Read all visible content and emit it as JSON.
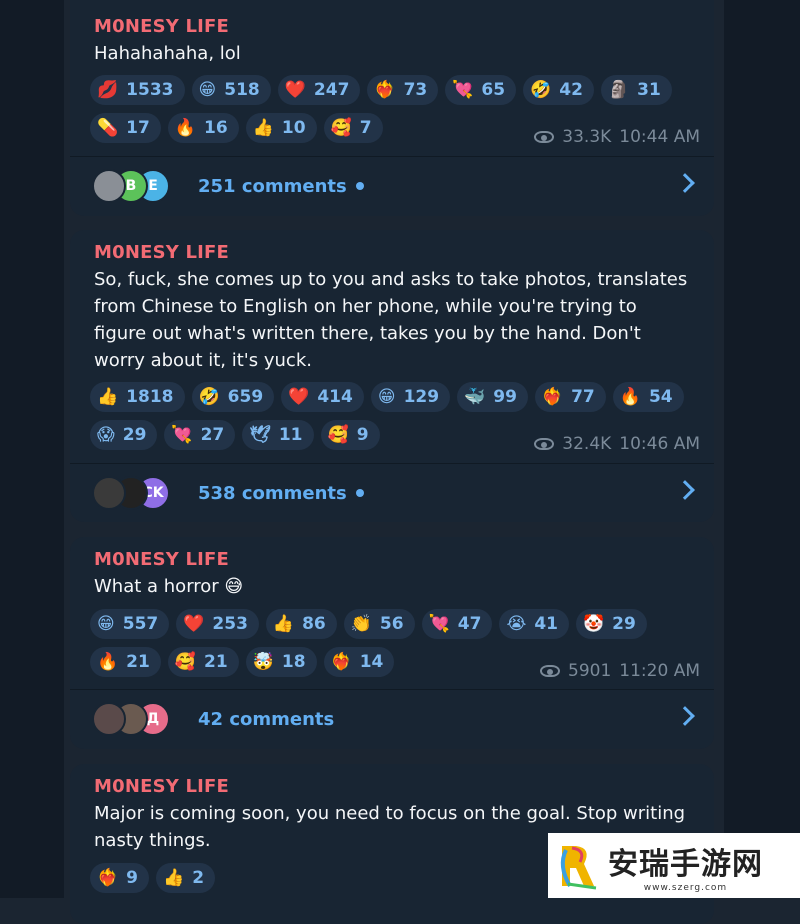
{
  "posts": [
    {
      "author": "M0NESY LIFE",
      "text": "Hahahahaha, lol",
      "reactions": [
        [
          {
            "emoji": "💋",
            "count": "1533"
          },
          {
            "emoji": "😁",
            "count": "518"
          },
          {
            "emoji": "❤️",
            "count": "247"
          },
          {
            "emoji": "❤️‍🔥",
            "count": "73"
          },
          {
            "emoji": "💘",
            "count": "65"
          },
          {
            "emoji": "🤣",
            "count": "42"
          },
          {
            "emoji": "🗿",
            "count": "31"
          }
        ],
        [
          {
            "emoji": "💊",
            "count": "17"
          },
          {
            "emoji": "🔥",
            "count": "16"
          },
          {
            "emoji": "👍",
            "count": "10"
          },
          {
            "emoji": "🥰",
            "count": "7"
          }
        ]
      ],
      "views": "33.3K",
      "time": "10:44 AM",
      "comments": "251 comments",
      "avatars": [
        {
          "letter": "",
          "color": "#8a8f96"
        },
        {
          "letter": "B",
          "color": "#5cc25a"
        },
        {
          "letter": "E",
          "color": "#4bb3e6"
        }
      ],
      "has_unread_dot": true
    },
    {
      "author": "M0NESY LIFE",
      "text": "So, fuck, she comes up to you and asks to take photos, translates from Chinese to English on her phone, while you're trying to figure out what's written there, takes you by the hand. Don't worry about it, it's yuck.",
      "reactions": [
        [
          {
            "emoji": "👍",
            "count": "1818"
          },
          {
            "emoji": "🤣",
            "count": "659"
          },
          {
            "emoji": "❤️",
            "count": "414"
          },
          {
            "emoji": "😁",
            "count": "129"
          },
          {
            "emoji": "🐳",
            "count": "99"
          },
          {
            "emoji": "❤️‍🔥",
            "count": "77"
          },
          {
            "emoji": "🔥",
            "count": "54"
          }
        ],
        [
          {
            "emoji": "😱",
            "count": "29"
          },
          {
            "emoji": "💘",
            "count": "27"
          },
          {
            "emoji": "🕊",
            "count": "11"
          },
          {
            "emoji": "🥰",
            "count": "9"
          }
        ]
      ],
      "views": "32.4K",
      "time": "10:46 AM",
      "comments": "538 comments",
      "avatars": [
        {
          "letter": "",
          "color": "#3a3a3a"
        },
        {
          "letter": "",
          "color": "#222222"
        },
        {
          "letter": "CK",
          "color": "#8f6ee6"
        }
      ],
      "has_unread_dot": true
    },
    {
      "author": "M0NESY LIFE",
      "text": "What a horror 😅",
      "reactions": [
        [
          {
            "emoji": "😁",
            "count": "557"
          },
          {
            "emoji": "❤️",
            "count": "253"
          },
          {
            "emoji": "👍",
            "count": "86"
          },
          {
            "emoji": "👏",
            "count": "56"
          },
          {
            "emoji": "💘",
            "count": "47"
          },
          {
            "emoji": "😭",
            "count": "41"
          },
          {
            "emoji": "🤡",
            "count": "29"
          }
        ],
        [
          {
            "emoji": "🔥",
            "count": "21"
          },
          {
            "emoji": "🥰",
            "count": "21"
          },
          {
            "emoji": "🤯",
            "count": "18"
          },
          {
            "emoji": "❤️‍🔥",
            "count": "14"
          }
        ]
      ],
      "views": "5901",
      "time": "11:20 AM",
      "comments": "42 comments",
      "avatars": [
        {
          "letter": "",
          "color": "#5a4a4a"
        },
        {
          "letter": "",
          "color": "#6a5a50"
        },
        {
          "letter": "Д",
          "color": "#e66c8a"
        }
      ],
      "has_unread_dot": false
    },
    {
      "author": "M0NESY LIFE",
      "text": "Major is coming soon, you need to focus on the goal. Stop writing nasty things.",
      "reactions": [
        [
          {
            "emoji": "❤️‍🔥",
            "count": "9"
          },
          {
            "emoji": "👍",
            "count": "2"
          }
        ]
      ]
    }
  ],
  "watermark": {
    "title": "安瑞手游网",
    "url": "www.szerg.com"
  }
}
